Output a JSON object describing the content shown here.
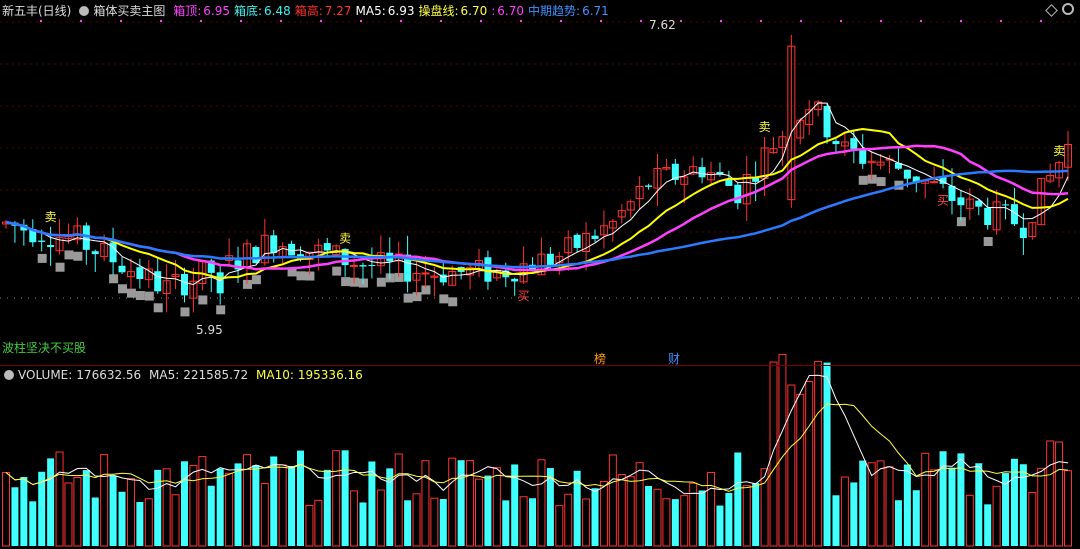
{
  "header": {
    "stock": "新五丰(日线)",
    "indicator": "箱体买卖主图",
    "items": [
      {
        "label": "箱顶:",
        "value": "6.95",
        "color": "#ff40ff"
      },
      {
        "label": "箱底:",
        "value": "6.48",
        "color": "#40f0f0"
      },
      {
        "label": "箱高:",
        "value": "7.27",
        "color": "#ff3030"
      },
      {
        "label": "MA5:",
        "value": "6.93",
        "color": "#ffffff"
      },
      {
        "label": "操盘线:",
        "value": "6.70",
        "color": "#ffff40"
      },
      {
        "label": ":",
        "value": "6.70",
        "color": "#ff40ff"
      },
      {
        "label": "中期趋势:",
        "value": "6.71",
        "color": "#4090ff"
      }
    ]
  },
  "volume_header": {
    "label": "VOLUME:",
    "value": "176632.56",
    "ma5_label": "MA5:",
    "ma5": "221585.72",
    "ma10_label": "MA10:",
    "ma10": "195336.16"
  },
  "annotations": {
    "high_price": "7.62",
    "low_price": "5.95",
    "bottom_text": "波柱坚决不买股",
    "tag_bang": "榜",
    "tag_cai": "财",
    "sell": "卖",
    "buy": "买"
  },
  "colors": {
    "up": "#ff3232",
    "down": "#40ffff",
    "ma5": "#ffffff",
    "cpx": "#ffff00",
    "box": "#ff40ff",
    "trend": "#2a7bff",
    "grey": "#9a9a9a"
  },
  "chart_data": {
    "type": "candlestick",
    "ylim": [
      5.7,
      7.7
    ],
    "bars": 120,
    "high": 7.62,
    "low": 5.95,
    "last_close": 6.93,
    "volume_last": 176632.56,
    "volume_ma5": 221585.72,
    "volume_ma10": 195336.16
  }
}
